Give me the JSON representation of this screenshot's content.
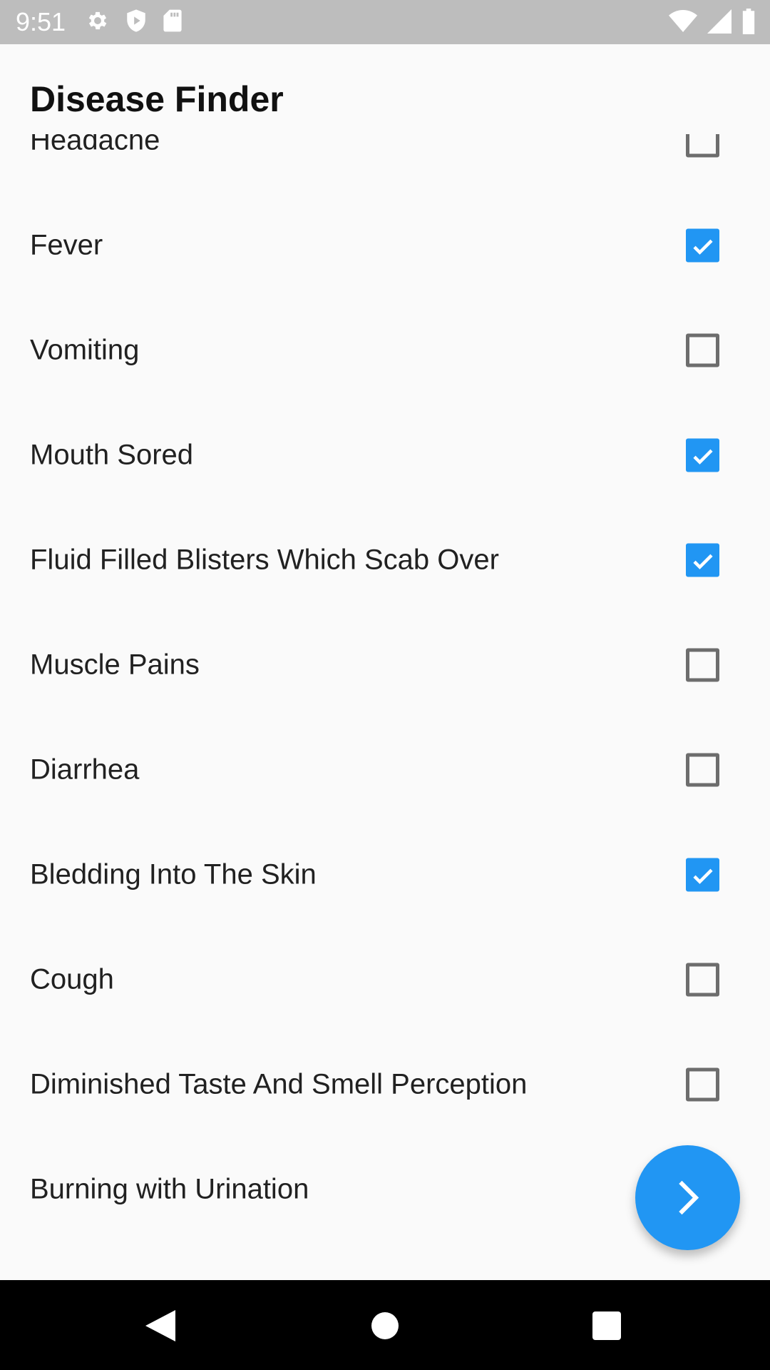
{
  "status_bar": {
    "time": "9:51",
    "left_icons": [
      "gear-icon",
      "shield-icon",
      "sd-card-icon"
    ],
    "right_icons": [
      "wifi-icon",
      "signal-icon",
      "battery-icon"
    ]
  },
  "header": {
    "title": "Disease Finder"
  },
  "symptoms": [
    {
      "label": "Headache",
      "checked": false
    },
    {
      "label": "Fever",
      "checked": true
    },
    {
      "label": "Vomiting",
      "checked": false
    },
    {
      "label": "Mouth Sored",
      "checked": true
    },
    {
      "label": "Fluid Filled Blisters Which Scab Over",
      "checked": true
    },
    {
      "label": "Muscle Pains",
      "checked": false
    },
    {
      "label": "Diarrhea",
      "checked": false
    },
    {
      "label": "Bledding Into The Skin",
      "checked": true
    },
    {
      "label": "Cough",
      "checked": false
    },
    {
      "label": "Diminished Taste And Smell Perception",
      "checked": false
    },
    {
      "label": "Burning with Urination",
      "checked": false
    }
  ],
  "fab": {
    "icon": "chevron-right-icon"
  },
  "nav_bar": {
    "icons": [
      "back-icon",
      "home-icon",
      "recents-icon"
    ]
  },
  "colors": {
    "accent": "#2196f3",
    "status_bar": "#bdbdbd",
    "background": "#fafafa"
  }
}
